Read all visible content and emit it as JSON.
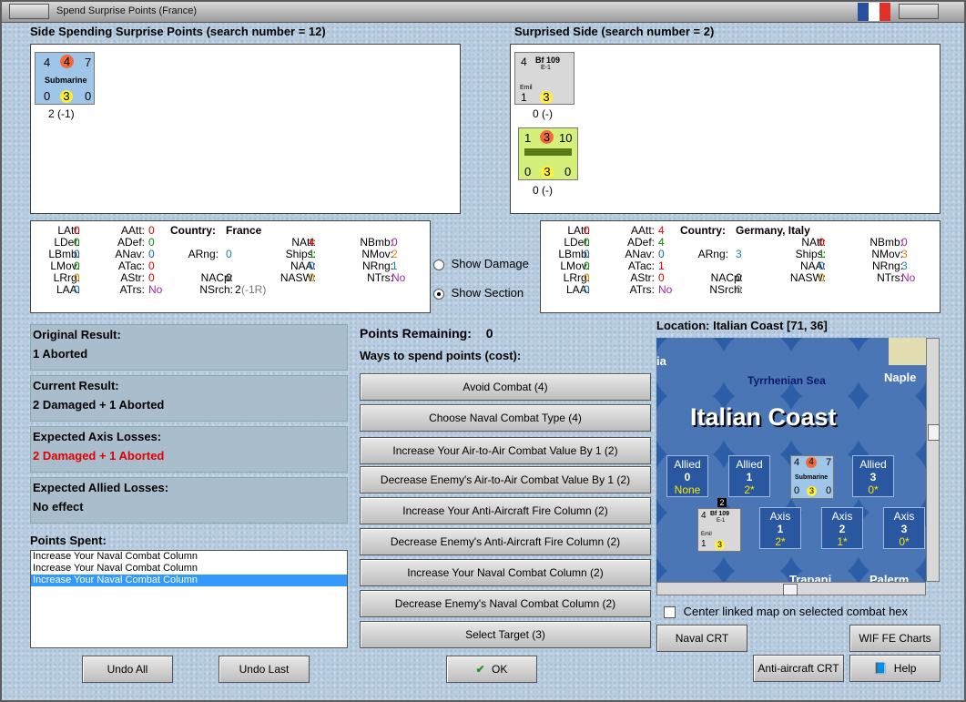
{
  "window": {
    "title": "Spend Surprise Points (France)"
  },
  "left": {
    "header": "Side Spending Surprise Points (search number = 12)",
    "counter": {
      "top_left": "4",
      "top_mid": "4",
      "top_right": "7",
      "name": "Submarine",
      "bot_left": "0",
      "bot_mid": "3",
      "bot_right": "0",
      "caption": "2 (-1)"
    },
    "stats": {
      "country_label": "Country:",
      "country": "France",
      "LAtt": "0",
      "LDef": "0",
      "LBmb": "0",
      "LMov": "0",
      "LRrg": "0",
      "LAA": "0",
      "AAtt": "0",
      "ADef": "0",
      "ANav": "0",
      "ATac": "0",
      "AStr": "0",
      "ATrs": "No",
      "ARng": "0",
      "NACp": "0",
      "NSrch": "2",
      "NSrch_note": "(-1R)",
      "NAtt": "4",
      "Ships": "1",
      "NAA": "0",
      "NASW": "0",
      "NBmb": "0",
      "NMov": "2",
      "NRng": "1",
      "NTrs": "No"
    }
  },
  "right": {
    "header": "Surprised Side (search number = 2)",
    "counter1": {
      "top_left": "4",
      "name": "Bf 109",
      "sub": "E-1",
      "sub2": "Emil",
      "bot_left": "1",
      "bot_mid": "3",
      "caption": "0 (-)"
    },
    "counter2": {
      "top_left": "1",
      "top_mid": "3",
      "top_right": "10",
      "bot_left": "0",
      "bot_mid": "3",
      "bot_right": "0",
      "caption": "0 (-)"
    },
    "stats": {
      "country_label": "Country:",
      "country": "Germany, Italy",
      "LAtt": "0",
      "LDef": "0",
      "LBmb": "0",
      "LMov": "0",
      "LRrg": "0",
      "LAA": "0",
      "AAtt": "4",
      "ADef": "4",
      "ANav": "0",
      "ATac": "1",
      "AStr": "0",
      "ATrs": "No",
      "ARng": "3",
      "NACp": "0",
      "NSrch": "0",
      "NAtt": "0",
      "Ships": "1",
      "NAA": "0",
      "NASW": "0",
      "NBmb": "0",
      "NMov": "3",
      "NRng": "3",
      "NTrs": "No"
    }
  },
  "options": {
    "show_damage": "Show Damage",
    "show_section": "Show Section",
    "selected": "show_section"
  },
  "results": {
    "original_label": "Original Result:",
    "original": "1 Aborted",
    "current_label": "Current Result:",
    "current": "2 Damaged + 1 Aborted",
    "axis_label": "Expected Axis Losses:",
    "axis": "2 Damaged + 1 Aborted",
    "allied_label": "Expected Allied Losses:",
    "allied": "No effect"
  },
  "points_spent": {
    "label": "Points Spent:",
    "items": [
      "Increase Your Naval Combat Column",
      "Increase Your Naval Combat Column",
      "Increase Your Naval Combat Column"
    ],
    "selected_index": 2
  },
  "points": {
    "remaining_label": "Points Remaining:",
    "remaining": "0",
    "ways_label": "Ways to spend points (cost):",
    "buttons": [
      "Avoid Combat (4)",
      "Choose Naval Combat Type (4)",
      "Increase Your Air-to-Air Combat Value By 1 (2)",
      "Decrease Enemy's Air-to-Air Combat Value By 1 (2)",
      "Increase Your Anti-Aircraft Fire Column (2)",
      "Decrease Enemy's Anti-Aircraft Fire Column (2)",
      "Increase Your Naval Combat Column (2)",
      "Decrease Enemy's Naval Combat Column (2)",
      "Select Target (3)"
    ]
  },
  "map": {
    "location_label": "Location:",
    "location": "Italian Coast [71, 36]",
    "sea_label": "Tyrrhenian Sea",
    "region_label": "Italian Coast",
    "edge_labels": [
      "ia",
      "Naple",
      "Trapani",
      "Palerm"
    ],
    "allied_boxes": [
      {
        "label": "Allied",
        "value": "0",
        "note": "None"
      },
      {
        "label": "Allied",
        "value": "1",
        "note": "2*"
      },
      {
        "label": "Allied",
        "value": "3",
        "note": "0*"
      }
    ],
    "axis_boxes": [
      {
        "label": "Axis",
        "value": "1",
        "note": "2*"
      },
      {
        "label": "Axis",
        "value": "2",
        "note": "1*"
      },
      {
        "label": "Axis",
        "value": "3",
        "note": "0*"
      }
    ],
    "stack_count": "2",
    "sub_counter": {
      "top_left": "4",
      "top_mid": "4",
      "top_right": "7",
      "name": "Submarine",
      "bot_left": "0",
      "bot_mid": "3",
      "bot_right": "0"
    },
    "bf_counter": {
      "top_left": "4",
      "name": "Bf 109",
      "sub": "E-1",
      "sub2": "Emil",
      "bot_left": "1",
      "bot_mid": "3"
    },
    "center_checkbox": "Center linked map on selected combat hex"
  },
  "bottom_buttons": {
    "undo_all": "Undo All",
    "undo_last": "Undo Last",
    "ok": "OK",
    "naval_crt": "Naval CRT",
    "wif_fe_charts": "WIF FE Charts",
    "aa_crt": "Anti-aircraft CRT",
    "help": "Help"
  },
  "colors": {
    "accent_red": "#e00000",
    "selected_row": "#3399ff"
  }
}
